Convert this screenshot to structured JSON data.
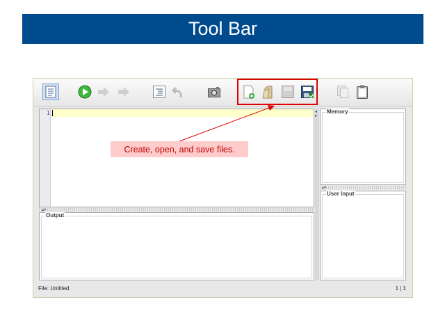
{
  "banner": {
    "title": "Tool Bar"
  },
  "editor": {
    "line_number": "1"
  },
  "panels": {
    "memory": "Memory",
    "user_input": "User Input",
    "output": "Output"
  },
  "status": {
    "file": "File: Untitled",
    "position": "1 | 1"
  },
  "callout": {
    "text": "Create, open, and save files."
  },
  "toolbar": {
    "icons": [
      "outline-icon",
      "run-icon",
      "step-icon",
      "step-over-icon",
      "indent-icon",
      "undo-icon",
      "camera-icon",
      "new-file-icon",
      "open-file-icon",
      "save-file-icon",
      "save-as-icon",
      "copy-icon",
      "paste-icon"
    ]
  },
  "colors": {
    "banner": "#004b8d",
    "highlight": "#e00000",
    "callout_bg": "#ffcccc",
    "callout_text": "#c00000"
  }
}
